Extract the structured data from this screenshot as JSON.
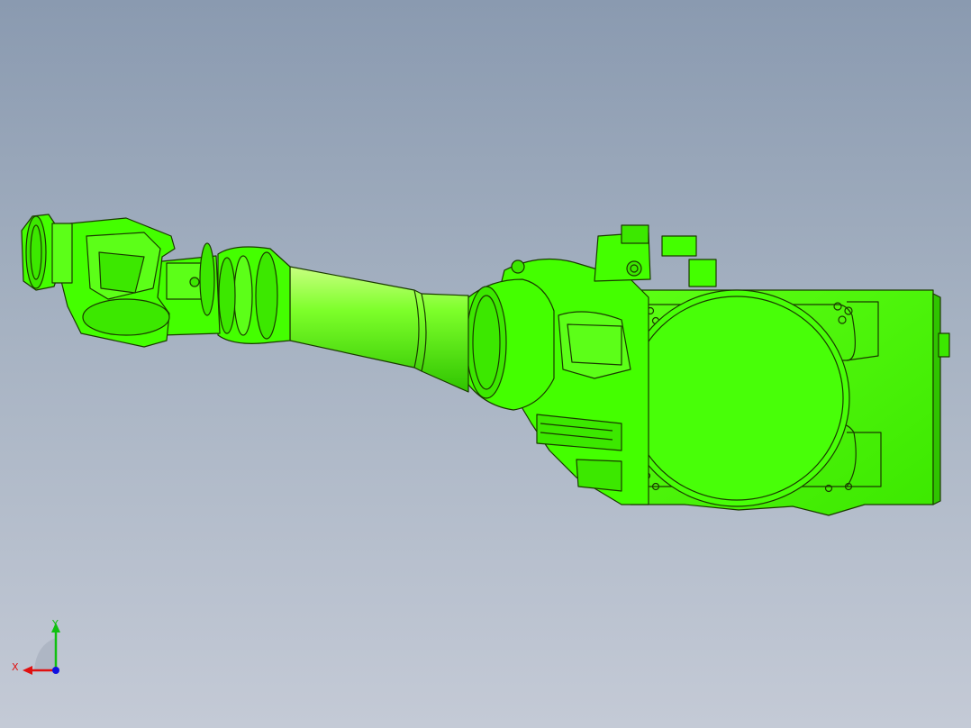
{
  "viewport": {
    "background_top": "#8a9ab0",
    "background_bottom": "#c4cad6"
  },
  "model": {
    "name": "robot-arm",
    "body_color": "#44ff00",
    "edge_color": "#1a3a00"
  },
  "triad": {
    "x_label": "X",
    "y_label": "Y",
    "x_color": "#e01010",
    "y_color": "#10c010",
    "z_color": "#1010e0"
  }
}
